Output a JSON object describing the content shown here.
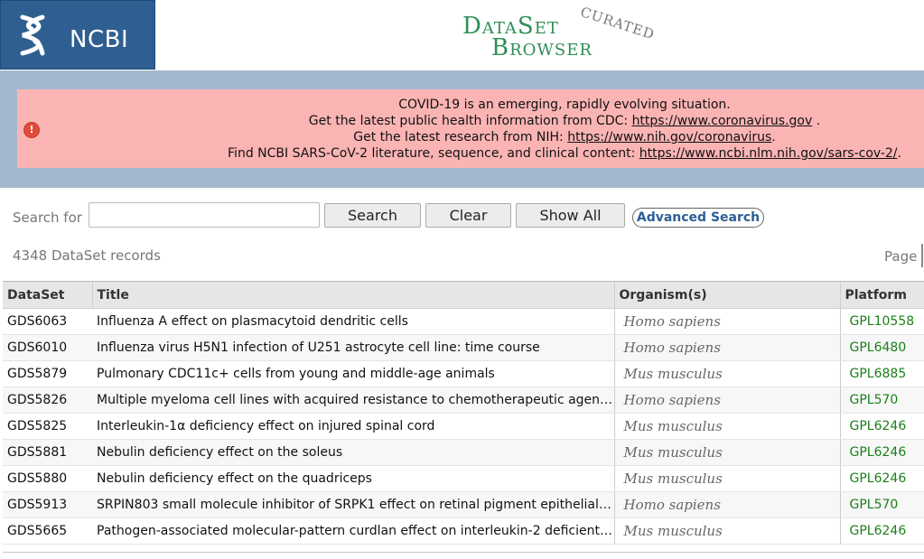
{
  "header": {
    "ncbi_label": "NCBI",
    "brand_line1": "DataSet",
    "brand_line2": "Browser",
    "brand_tag": "CURATED"
  },
  "alert": {
    "line1": "COVID-19 is an emerging, rapidly evolving situation.",
    "line2_prefix": "Get the latest public health information from CDC: ",
    "line2_link": "https://www.coronavirus.gov",
    "line2_suffix": " .",
    "line3_prefix": "Get the latest research from NIH: ",
    "line3_link": "https://www.nih.gov/coronavirus",
    "line3_suffix": ".",
    "line4_prefix": "Find NCBI SARS-CoV-2 literature, sequence, and clinical content: ",
    "line4_link": "https://www.ncbi.nlm.nih.gov/sars-cov-2/",
    "line4_suffix": "."
  },
  "search": {
    "label": "Search for",
    "value": "",
    "search_label": "Search",
    "clear_label": "Clear",
    "show_all_label": "Show All",
    "advanced_label": "Advanced Search"
  },
  "records_text": "4348 DataSet records",
  "page_label": "Page",
  "table": {
    "headers": [
      "DataSet",
      "Title",
      "Organism(s)",
      "Platform"
    ],
    "rows": [
      {
        "id": "GDS6063",
        "title": "Influenza A effect on plasmacytoid dendritic cells",
        "organism": "Homo sapiens",
        "platform": "GPL10558"
      },
      {
        "id": "GDS6010",
        "title": "Influenza virus H5N1 infection of U251 astrocyte cell line: time course",
        "organism": "Homo sapiens",
        "platform": "GPL6480"
      },
      {
        "id": "GDS5879",
        "title": "Pulmonary CDC11c+ cells from young and middle-age animals",
        "organism": "Mus musculus",
        "platform": "GPL6885"
      },
      {
        "id": "GDS5826",
        "title": "Multiple myeloma cell lines with acquired resistance to chemotherapeutic agent ...",
        "organism": "Homo sapiens",
        "platform": "GPL570"
      },
      {
        "id": "GDS5825",
        "title": "Interleukin-1α deficiency effect on injured spinal cord",
        "organism": "Mus musculus",
        "platform": "GPL6246"
      },
      {
        "id": "GDS5881",
        "title": "Nebulin deficiency effect on the soleus",
        "organism": "Mus musculus",
        "platform": "GPL6246"
      },
      {
        "id": "GDS5880",
        "title": "Nebulin deficiency effect on the quadriceps",
        "organism": "Mus musculus",
        "platform": "GPL6246"
      },
      {
        "id": "GDS5913",
        "title": "SRPIN803 small molecule inhibitor of SRPK1 effect on retinal pigment epithelial c...",
        "organism": "Homo sapiens",
        "platform": "GPL570"
      },
      {
        "id": "GDS5665",
        "title": "Pathogen-associated molecular-pattern curdlan effect on interleukin-2 deficient ...",
        "organism": "Mus musculus",
        "platform": "GPL6246"
      }
    ]
  },
  "colors": {
    "ncbi_blue": "#2f5f90",
    "brand_green": "#2f8f55",
    "alert_bg": "#fbb4b4",
    "band_bg": "#a3b8cd",
    "platform_green": "#1a7f1a",
    "advanced_blue": "#2b5f95"
  },
  "icons": {
    "ncbi_helix": "dna-helix-icon",
    "alert": "alert-circle-icon"
  }
}
